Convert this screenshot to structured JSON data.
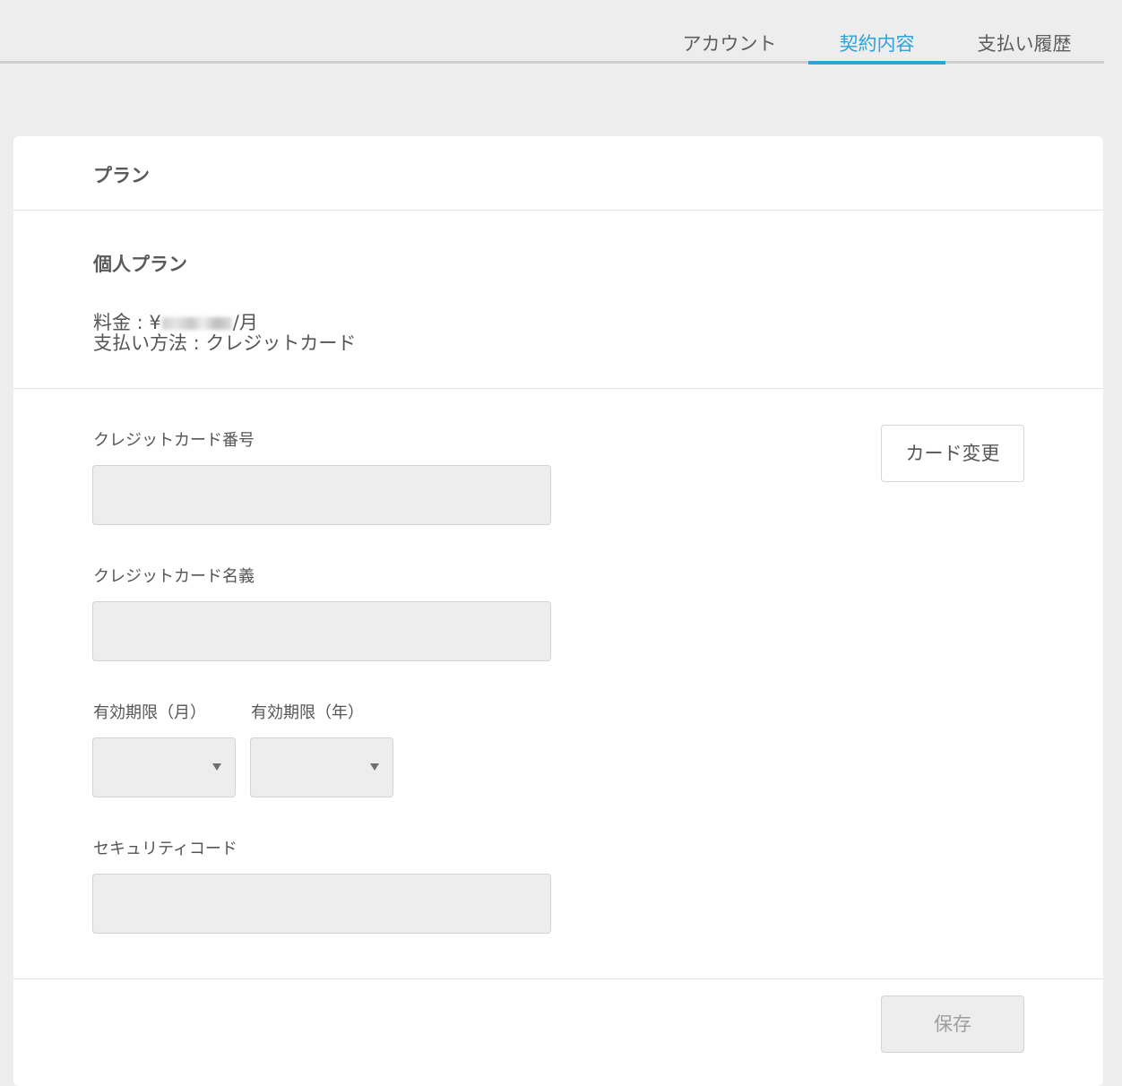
{
  "tabs": [
    {
      "label": "アカウント",
      "active": false
    },
    {
      "label": "契約内容",
      "active": true
    },
    {
      "label": "支払い履歴",
      "active": false
    }
  ],
  "colors": {
    "accent": "#2ea3d9",
    "background": "#ededed",
    "card": "#ffffff",
    "input_bg": "#ededed"
  },
  "plan_section": {
    "title": "プラン",
    "plan_name": "個人プラン",
    "fee_label": "料金 : ¥",
    "fee_suffix": "/月",
    "payment_method": "支払い方法 : クレジットカード"
  },
  "form": {
    "card_number_label": "クレジットカード番号",
    "card_name_label": "クレジットカード名義",
    "expiry_month_label": "有効期限（月）",
    "expiry_year_label": "有効期限（年）",
    "security_code_label": "セキュリティコード",
    "card_number_value": "",
    "card_name_value": "",
    "security_code_value": ""
  },
  "buttons": {
    "change_card": "カード変更",
    "save": "保存"
  }
}
